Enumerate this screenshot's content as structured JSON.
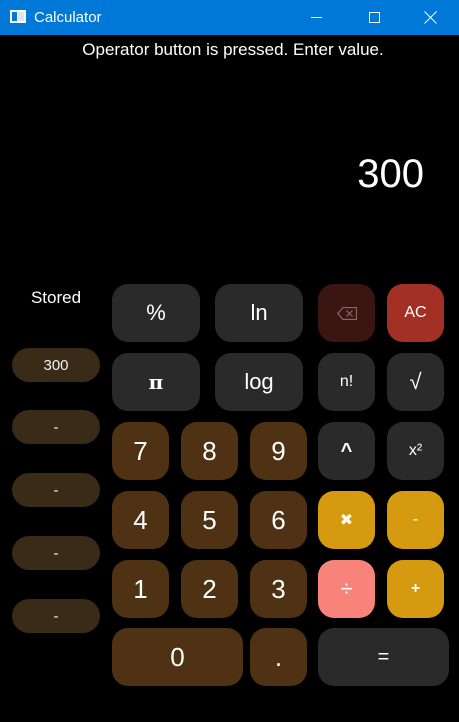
{
  "window": {
    "title": "Calculator",
    "icons": {
      "app": "calculator-app-icon",
      "minimize": "minimize-icon",
      "maximize": "maximize-icon",
      "close": "close-icon"
    },
    "titlebar_color": "#0078d7"
  },
  "status": {
    "message": "Operator button is pressed. Enter value."
  },
  "display": {
    "value": "300"
  },
  "memory": {
    "label": "Stored",
    "slots": [
      "300",
      "-",
      "-",
      "-",
      "-"
    ]
  },
  "keypad": {
    "percent": "%",
    "ln": "ln",
    "backspace_icon": "backspace-icon",
    "all_clear": "AC",
    "pi": "π",
    "log": "log",
    "factorial": "n!",
    "sqrt": "√",
    "digit_7": "7",
    "digit_8": "8",
    "digit_9": "9",
    "power": "^",
    "square": "x²",
    "digit_4": "4",
    "digit_5": "5",
    "digit_6": "6",
    "multiply": "✖",
    "subtract": "-",
    "digit_1": "1",
    "digit_2": "2",
    "digit_3": "3",
    "divide": "÷",
    "add": "+",
    "digit_0": "0",
    "decimal": ".",
    "equals": "="
  },
  "colors": {
    "function_key": "#2a2a2a",
    "digit_key": "#4e3213",
    "operator_key": "#d69a10",
    "active_operator_key": "#f7837b",
    "clear_key": "#a23025",
    "memory_slot": "#3a2b18"
  }
}
